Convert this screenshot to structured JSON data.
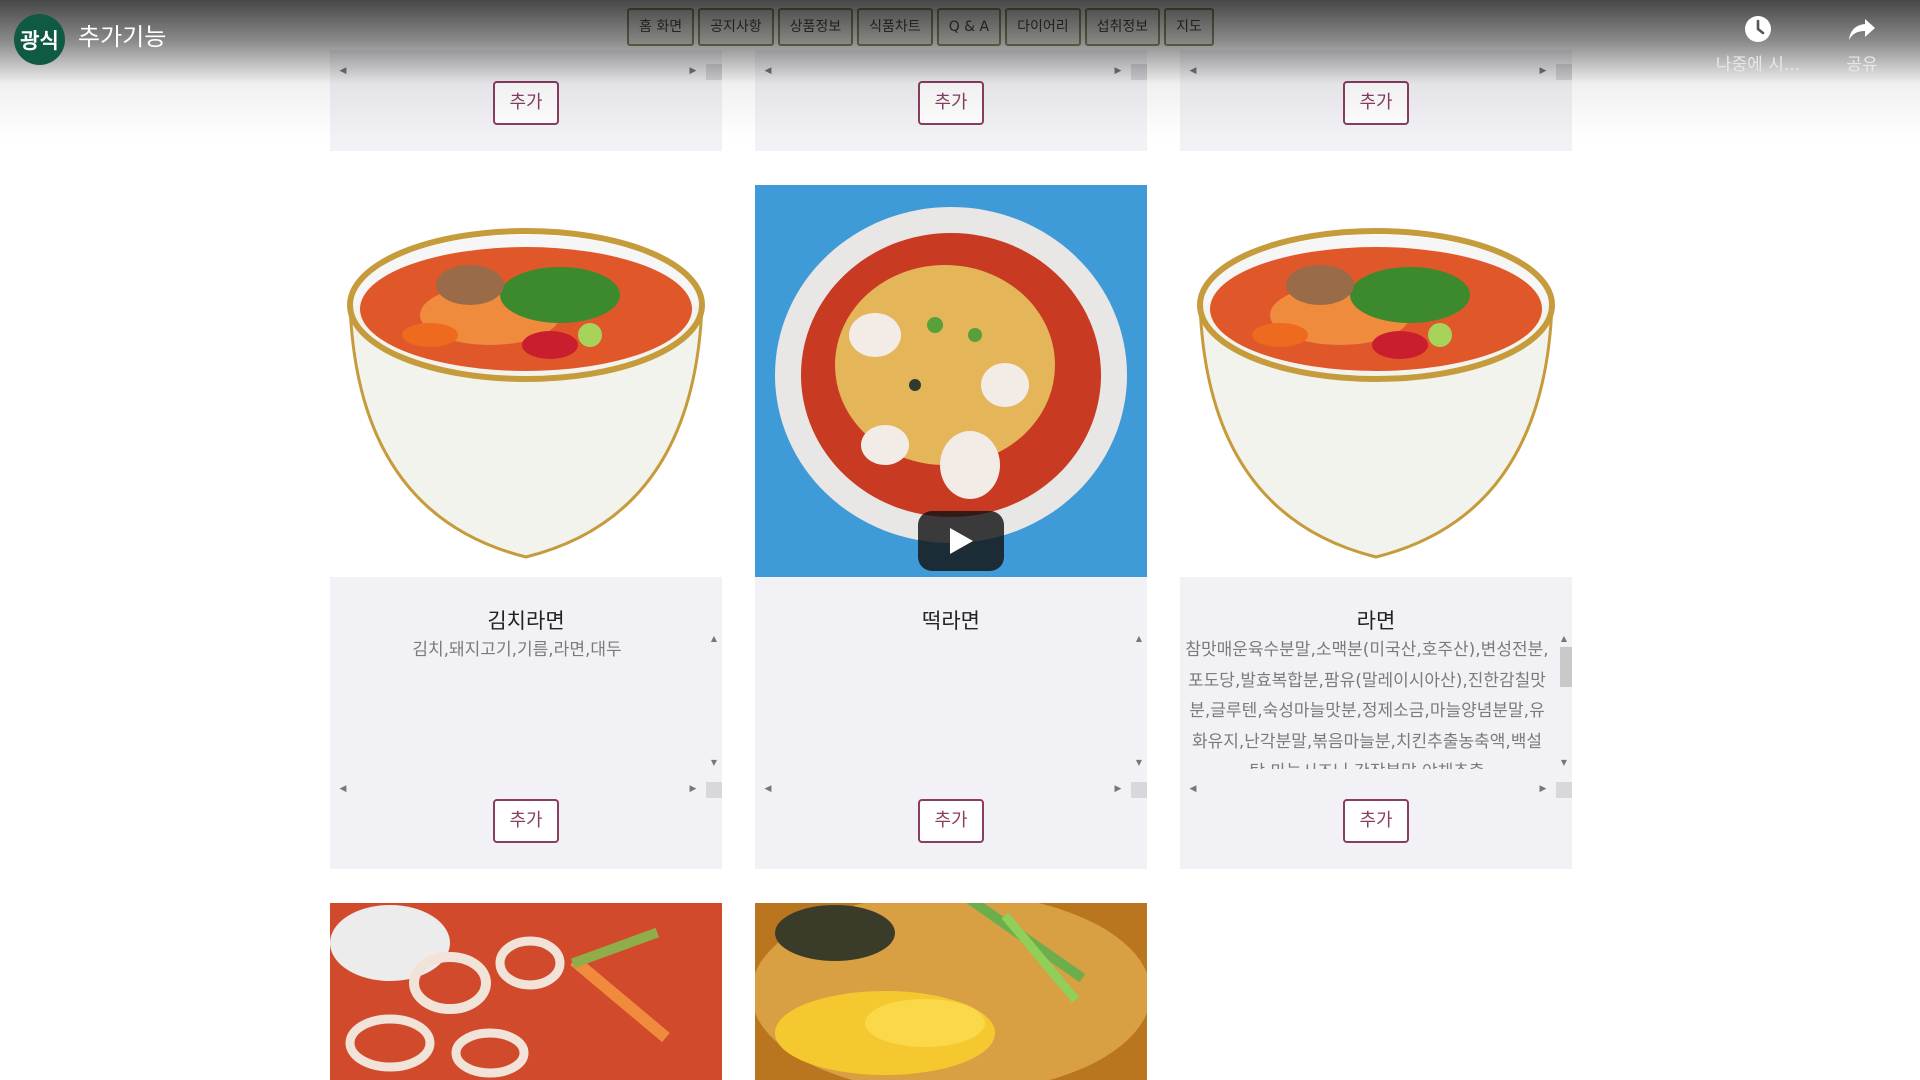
{
  "video": {
    "channel_avatar": "광식",
    "title": "추가기능",
    "watch_later": "나중에 시...",
    "share": "공유",
    "watch_later_icon": "clock-icon",
    "share_icon": "share-arrow-icon",
    "play_icon": "play-icon"
  },
  "site_nav": {
    "items": [
      "홈 화면",
      "공지사항",
      "상품정보",
      "식품차트",
      "Q & A",
      "다이어리",
      "섭취정보",
      "지도"
    ]
  },
  "products": {
    "add_label": "추가",
    "row1": [
      "",
      "",
      ""
    ],
    "row2": [
      {
        "name": "김치라면",
        "description": "김치,돼지고기,기름,라면,대두"
      },
      {
        "name": "떡라면",
        "description": ""
      },
      {
        "name": "라면",
        "description": "참맛매운육수분말,소맥분(미국산,호주산),변성전분,포도당,발효복합분,팜유(말레이시아산),진한감칠맛분,글루텐,숙성마늘맛분,정제소금,마늘양념분말,유화유지,난각분말,볶음마늘분,치킨추출농축액,백설탕,마늘시즈닝,간장분말,야채추출"
      }
    ]
  },
  "colors": {
    "card_bg": "#f2f2f6",
    "add_button": "#8a3d62",
    "nav_border": "#8e9a6b",
    "avatar_bg": "#0f5a45"
  }
}
